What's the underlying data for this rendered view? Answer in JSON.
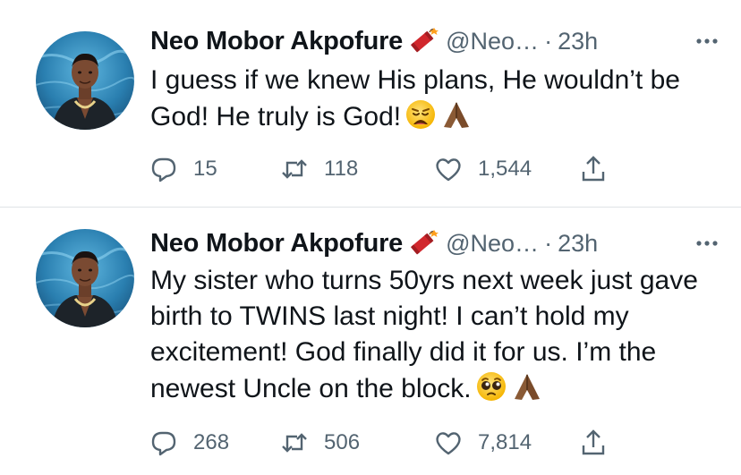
{
  "tweets": [
    {
      "author": {
        "name": "Neo Mobor Akpofure",
        "handle": "@Neo…",
        "badge_icon": "firecracker-icon"
      },
      "separator": "·",
      "time": "23h",
      "text": "I guess if we knew His plans, He wouldn’t be God! He truly is God!",
      "emojis": [
        "weary-face-emoji",
        "folded-hands-emoji"
      ],
      "stats": {
        "replies": "15",
        "retweets": "118",
        "likes": "1,544"
      }
    },
    {
      "author": {
        "name": "Neo Mobor Akpofure",
        "handle": "@Neo…",
        "badge_icon": "firecracker-icon"
      },
      "separator": "·",
      "time": "23h",
      "text": "My sister who turns 50yrs next week just gave birth to TWINS last night! I can’t hold my excitement! God finally did it for us. I’m the newest Uncle on the block.",
      "emojis": [
        "pleading-face-emoji",
        "folded-hands-emoji"
      ],
      "stats": {
        "replies": "268",
        "retweets": "506",
        "likes": "7,814"
      }
    }
  ],
  "colors": {
    "text": "#0f1419",
    "secondary": "#536471",
    "divider": "#dfe3e6",
    "avatar_bg": "#2a7fb0"
  }
}
